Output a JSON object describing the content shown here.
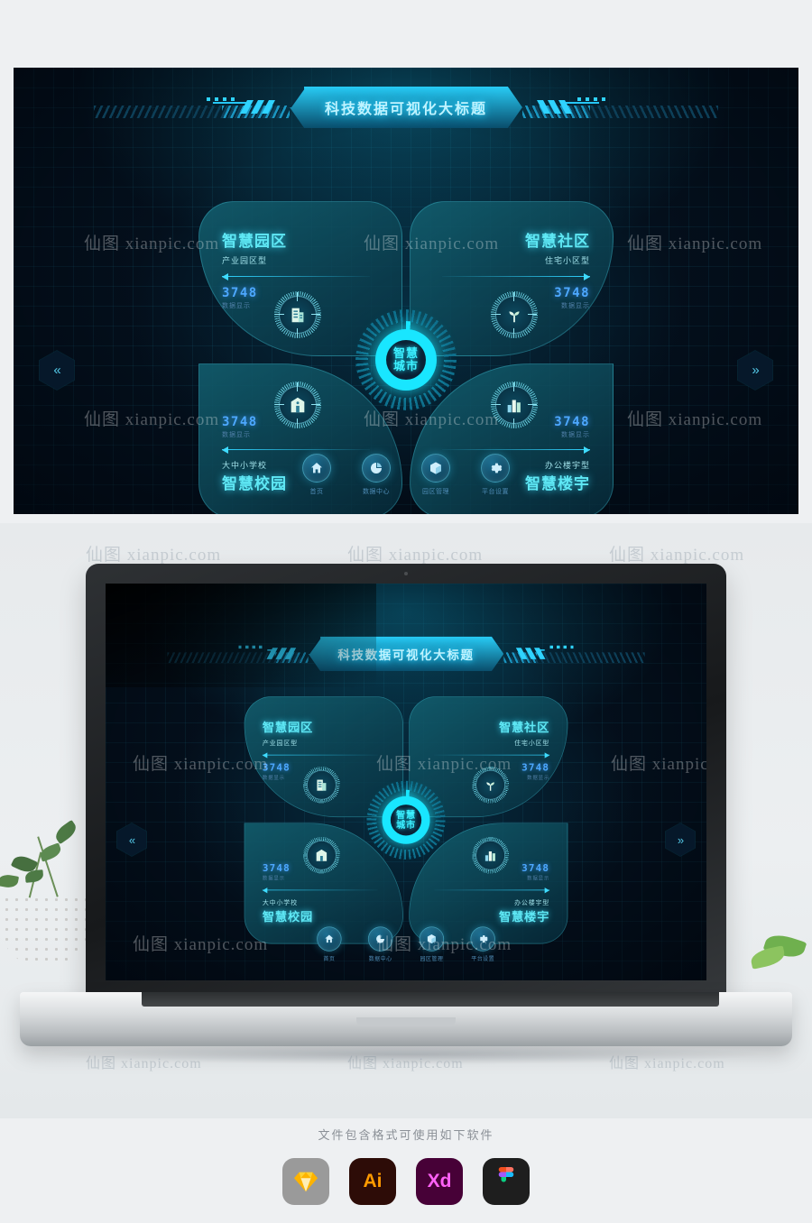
{
  "dashboard": {
    "title": "科技数据可视化大标题",
    "center": {
      "line1": "智慧",
      "line2": "城市"
    },
    "nav_left_icon": "«",
    "nav_right_icon": "»",
    "quadrants": [
      {
        "id": "tl",
        "title": "智慧园区",
        "subtitle": "产业园区型",
        "value": "3748",
        "value_label": "数据显示",
        "icon": "building-icon"
      },
      {
        "id": "tr",
        "title": "智慧社区",
        "subtitle": "住宅小区型",
        "value": "3748",
        "value_label": "数据显示",
        "icon": "sprout-icon"
      },
      {
        "id": "bl",
        "title": "智慧校园",
        "subtitle": "大中小学校",
        "value": "3748",
        "value_label": "数据显示",
        "icon": "school-icon"
      },
      {
        "id": "br",
        "title": "智慧楼宇",
        "subtitle": "办公楼宇型",
        "value": "3748",
        "value_label": "数据显示",
        "icon": "chart-building-icon"
      }
    ],
    "nav": [
      {
        "label": "首页",
        "icon": "home-icon"
      },
      {
        "label": "数据中心",
        "icon": "pie-chart-icon"
      },
      {
        "label": "园区管理",
        "icon": "cube-icon"
      },
      {
        "label": "平台设置",
        "icon": "gear-icon"
      }
    ],
    "colors": {
      "background": "#04101d",
      "accent": "#19e6ff",
      "petal": "#125c6c",
      "value": "#4da8ff",
      "title_text": "#bff3ff"
    }
  },
  "watermark": {
    "text": "仙图 xianpic.com"
  },
  "footer": {
    "note": "文件包含格式可使用如下软件",
    "software": [
      {
        "name": "Sketch",
        "label": "",
        "bg": "#9a9a9a"
      },
      {
        "name": "Adobe Illustrator",
        "label": "Ai",
        "bg": "#2d0c07",
        "fg": "#ff9a00"
      },
      {
        "name": "Adobe XD",
        "label": "Xd",
        "bg": "#470137",
        "fg": "#ff61f6"
      },
      {
        "name": "Figma",
        "label": "",
        "bg": "#1e1e1e"
      }
    ]
  }
}
